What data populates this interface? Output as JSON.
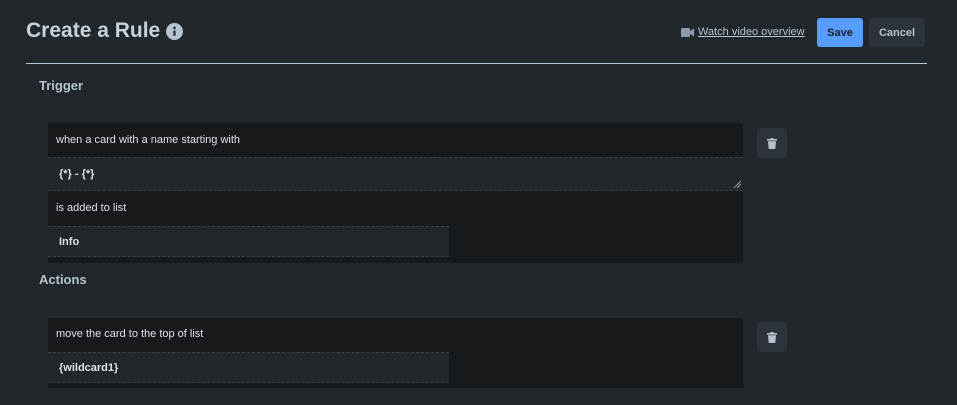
{
  "header": {
    "title": "Create a Rule",
    "video_link": "Watch video overview",
    "save_label": "Save",
    "cancel_label": "Cancel"
  },
  "trigger": {
    "section_label": "Trigger",
    "line1": "when a card with a name starting with",
    "name_value": "{*} - {*}",
    "line2": "is added to list",
    "list_value": "Info"
  },
  "actions": {
    "section_label": "Actions",
    "line1": "move the card to the top of list",
    "list_value": "{wildcard1}"
  },
  "icons": {
    "info": "info-icon",
    "video": "video-camera-icon",
    "trash": "trash-icon"
  },
  "colors": {
    "background": "#22272b",
    "card": "#161a1d",
    "primary": "#579dff"
  }
}
